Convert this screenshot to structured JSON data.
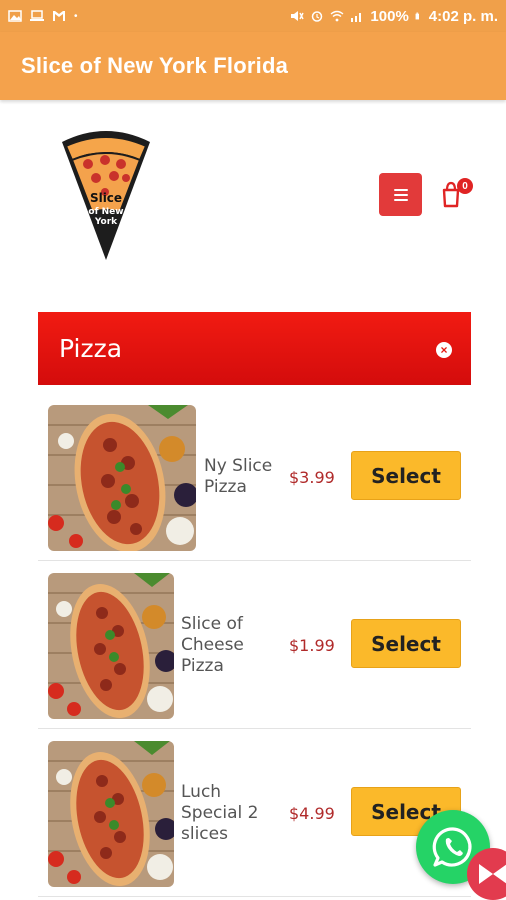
{
  "status_bar": {
    "battery": "100%",
    "time": "4:02 p. m.",
    "icons": [
      "gallery-icon",
      "laptop-icon",
      "gmail-icon",
      "dot-icon",
      "mute-icon",
      "alarm-icon",
      "wifi-icon",
      "signal-icon",
      "battery-icon"
    ]
  },
  "app_bar": {
    "title": "Slice of New York Florida"
  },
  "header": {
    "logo_text": "Slice of New York",
    "menu_icon": "hamburger-icon",
    "cart_count": "0"
  },
  "category": {
    "title": "Pizza"
  },
  "items": [
    {
      "name": "Ny Slice Pizza",
      "name_lines": [
        "Ny Slice",
        "Pizza"
      ],
      "price": "$3.99",
      "button": "Select"
    },
    {
      "name": "Slice of Cheese Pizza",
      "name_lines": [
        "Slice of",
        "Cheese",
        "Pizza"
      ],
      "price": "$1.99",
      "button": "Select"
    },
    {
      "name": "Luch Special 2 slices",
      "name_lines": [
        "Luch",
        "Special 2",
        "slices"
      ],
      "price": "$4.99",
      "button": "Select"
    }
  ],
  "colors": {
    "app_bar": "#f4a24c",
    "category_bar": "#e41a12",
    "price": "#b02a2a",
    "select_button": "#fbb92a",
    "menu_button": "#e23a3a",
    "whatsapp": "#25d366"
  }
}
